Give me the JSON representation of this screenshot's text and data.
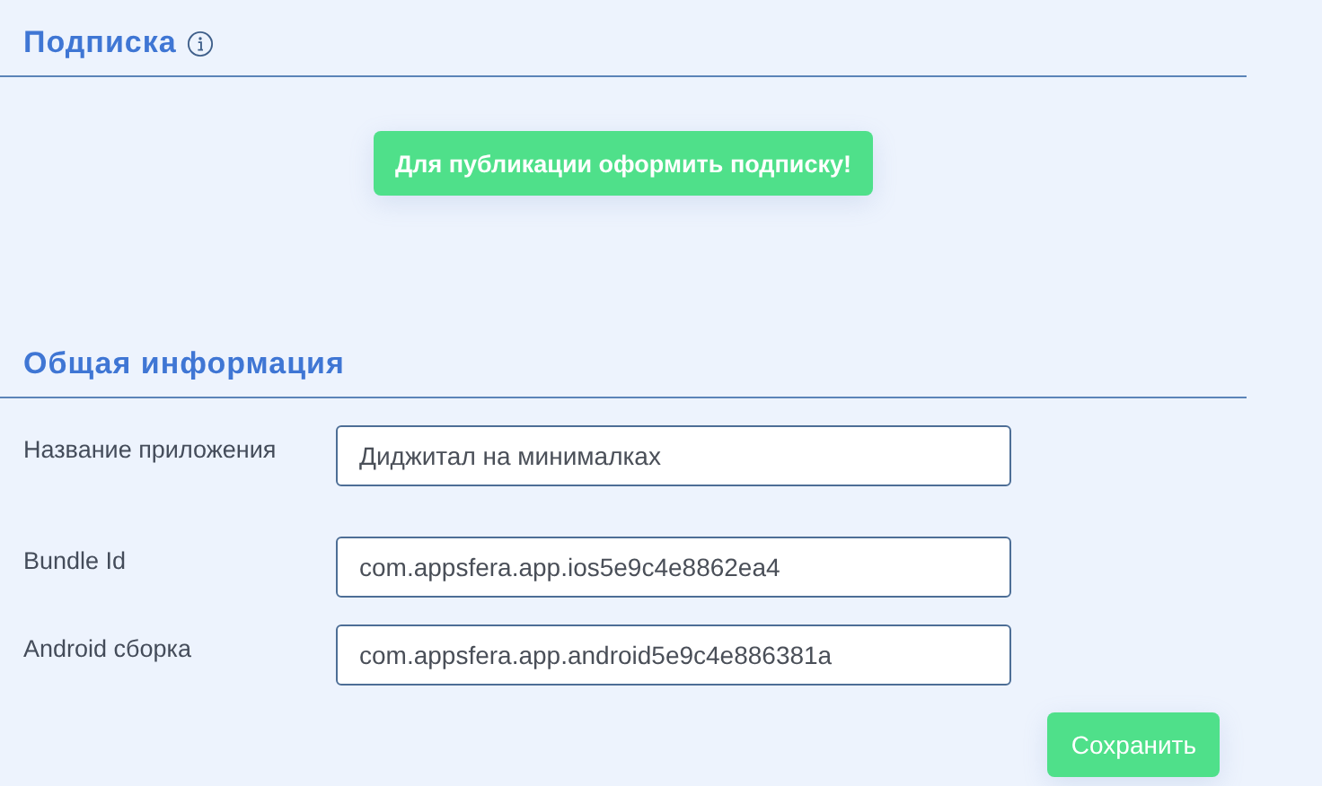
{
  "subscription": {
    "title": "Подписка",
    "button": "Для публикации оформить подписку!"
  },
  "general": {
    "title": "Общая информация",
    "fields": [
      {
        "label": "Название приложения",
        "value": "Диджитал на минималках"
      },
      {
        "label": "Bundle Id",
        "value": "com.appsfera.app.ios5e9c4e8862ea4"
      },
      {
        "label": "Android сборка",
        "value": "com.appsfera.app.android5e9c4e886381a"
      }
    ],
    "save_button": "Сохранить"
  }
}
